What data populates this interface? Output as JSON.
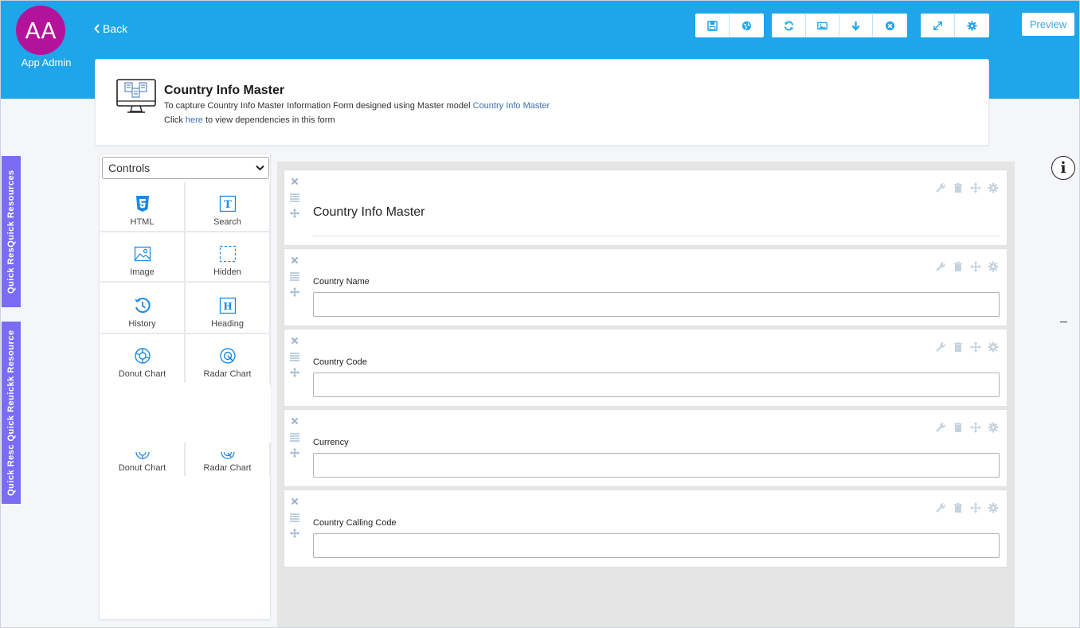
{
  "user": {
    "initials": "AA",
    "name": "App Admin"
  },
  "nav": {
    "back_label": "Back"
  },
  "toolbar": {
    "groups": [
      [
        "save-icon",
        "globe-icon"
      ],
      [
        "refresh-icon",
        "image-icon",
        "download-icon",
        "close-circle-icon"
      ],
      [
        "expand-icon",
        "gear-icon"
      ]
    ],
    "preview_label": "Preview",
    "icon_color": "#1ea5ea"
  },
  "header": {
    "title": "Country Info Master",
    "desc_prefix": "To capture Country Info Master Information Form designed using Master model ",
    "desc_link": "Country Info Master",
    "dep_prefix": "Click ",
    "dep_link": "here",
    "dep_suffix": " to view dependencies in this form"
  },
  "quick_tabs": [
    {
      "label": "Quick ResQuick Resources"
    },
    {
      "label": "Quick Resc Quick Reuickk Resource"
    }
  ],
  "controls": {
    "select_value": "Controls",
    "items": [
      {
        "label": "HTML",
        "icon": "html5-icon"
      },
      {
        "label": "Search",
        "icon": "text-box-icon"
      },
      {
        "label": "Image",
        "icon": "image-icon"
      },
      {
        "label": "Hidden",
        "icon": "dashed-box-icon"
      },
      {
        "label": "History",
        "icon": "history-icon"
      },
      {
        "label": "Heading",
        "icon": "heading-icon"
      },
      {
        "label": "Donut Chart",
        "icon": "donut-chart-icon"
      },
      {
        "label": "Radar Chart",
        "icon": "radar-chart-icon"
      }
    ],
    "ghost_items": [
      {
        "label": "Donut Chart"
      },
      {
        "label": "Radar Chart"
      }
    ]
  },
  "form": {
    "heading": "Country Info Master",
    "fields": [
      {
        "label": "Country Name",
        "value": ""
      },
      {
        "label": "Country Code",
        "value": ""
      },
      {
        "label": "Currency",
        "value": ""
      },
      {
        "label": "Country Calling Code",
        "value": ""
      }
    ]
  },
  "colors": {
    "topbar": "#1ea5ea",
    "avatar": "#b3139a",
    "quick_tab": "#7a6cf3",
    "link": "#3b6fb6"
  }
}
